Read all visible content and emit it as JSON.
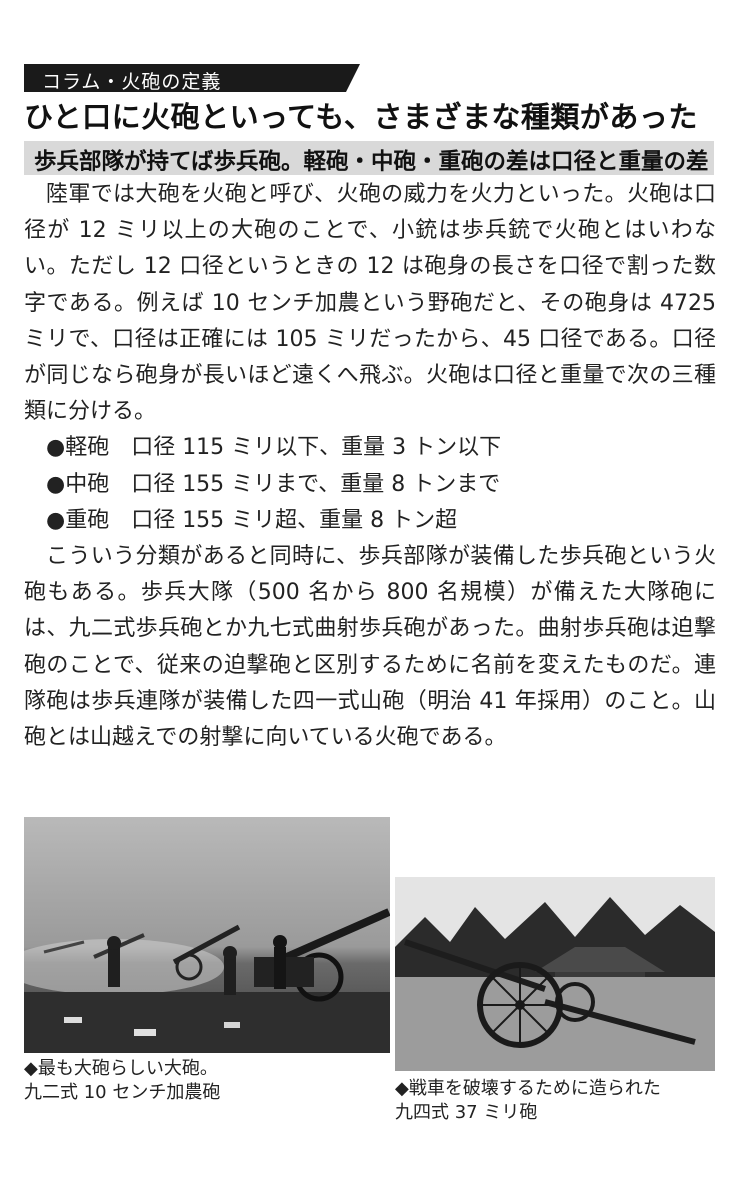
{
  "column_label": "コラム・火砲の定義",
  "headline": "ひと口に火砲といっても、さまざまな種類があった",
  "subheadline": "歩兵部隊が持てば歩兵砲。軽砲・中砲・重砲の差は口径と重量の差",
  "paragraphs": {
    "p1": "陸軍では大砲を火砲と呼び、火砲の威力を火力といった。火砲は口径が 12 ミリ以上の大砲のことで、小銃は歩兵銃で火砲とはいわない。ただし 12 口径というときの 12 は砲身の長さを口径で割った数字である。例えば 10 センチ加農という野砲だと、その砲身は 4725 ミリで、口径は正確には 105 ミリだったから、45 口径である。口径が同じなら砲身が長いほど遠くへ飛ぶ。火砲は口径と重量で次の三種類に分ける。",
    "bullet1": "●軽砲　口径 115 ミリ以下、重量 3 トン以下",
    "bullet2": "●中砲　口径 155 ミリまで、重量 8 トンまで",
    "bullet3": "●重砲　口径 155 ミリ超、重量 8 トン超",
    "p2": "こういう分類があると同時に、歩兵部隊が装備した歩兵砲という火砲もある。歩兵大隊（500 名から 800 名規模）が備えた大隊砲には、九二式歩兵砲とか九七式曲射歩兵砲があった。曲射歩兵砲は迫撃砲のことで、従来の迫撃砲と区別するために名前を変えたものだ。連隊砲は歩兵連隊が装備した四一式山砲（明治 41 年採用）のこと。山砲とは山越えでの射撃に向いている火砲である。"
  },
  "captions": {
    "left_line1": "◆最も大砲らしい大砲。",
    "left_line2": "九二式 10 センチ加農砲",
    "right_line1": "◆戦車を破壊するために造られた",
    "right_line2": "九四式 37 ミリ砲"
  }
}
